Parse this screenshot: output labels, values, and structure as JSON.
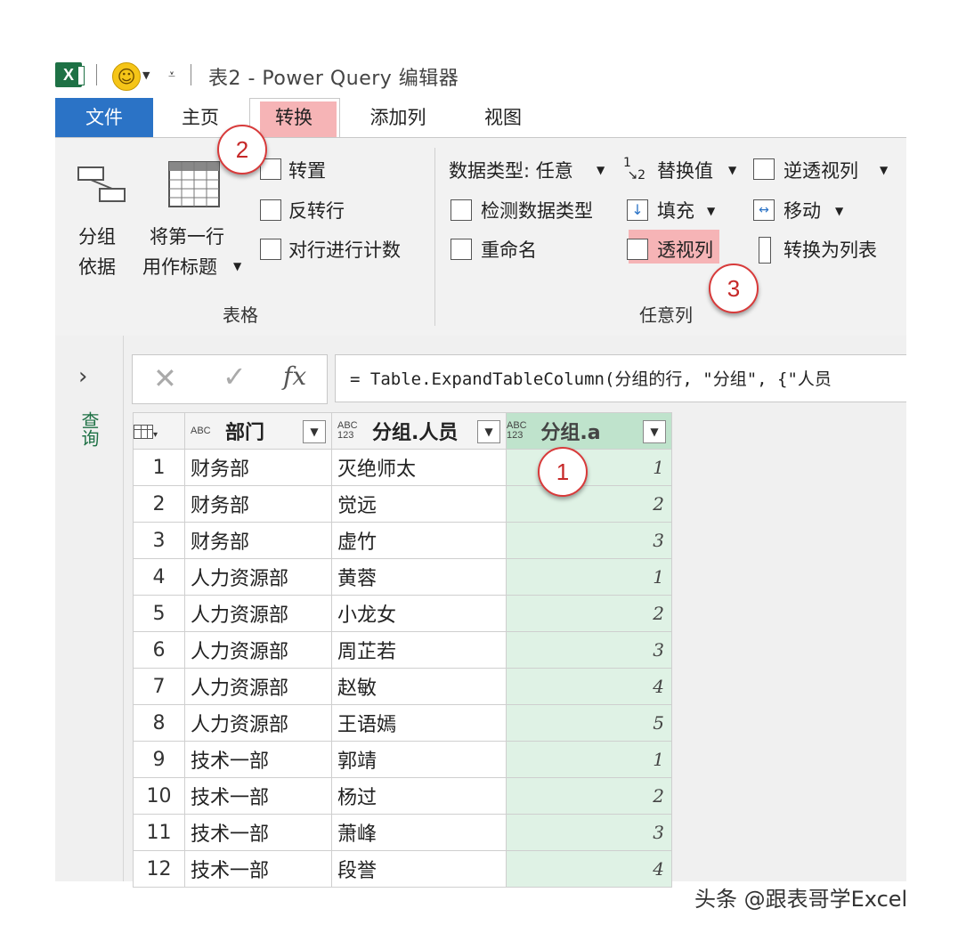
{
  "window": {
    "title": "表2 - Power Query 编辑器"
  },
  "tabs": {
    "file": "文件",
    "home": "主页",
    "transform": "转换",
    "add_column": "添加列",
    "view": "视图"
  },
  "ribbon": {
    "table_group": {
      "label": "表格",
      "group_by_line1": "分组",
      "group_by_line2": "依据",
      "use_first_row_line1": "将第一行",
      "use_first_row_line2": "用作标题",
      "transpose": "转置",
      "reverse_rows": "反转行",
      "count_rows": "对行进行计数"
    },
    "any_column_group": {
      "label": "任意列",
      "data_type": "数据类型: 任意",
      "detect_type": "检测数据类型",
      "rename": "重命名",
      "replace_values": "替换值",
      "fill": "填充",
      "pivot_column": "透视列",
      "unpivot_columns": "逆透视列",
      "move": "移动",
      "convert_to_list": "转换为列表"
    }
  },
  "callouts": {
    "one": "1",
    "two": "2",
    "three": "3"
  },
  "side_panel": {
    "label": "查询"
  },
  "formula_bar": {
    "fx": "fx",
    "formula": "= Table.ExpandTableColumn(分组的行, \"分组\", {\"人员"
  },
  "table": {
    "columns": [
      {
        "type": "ABC",
        "name": "部门"
      },
      {
        "type": "ABC 123",
        "name": "分组.人员"
      },
      {
        "type": "ABC 123",
        "name": "分组.a"
      }
    ],
    "rows": [
      {
        "n": "1",
        "dept": "财务部",
        "person": "灭绝师太",
        "a": "1"
      },
      {
        "n": "2",
        "dept": "财务部",
        "person": "觉远",
        "a": "2"
      },
      {
        "n": "3",
        "dept": "财务部",
        "person": "虚竹",
        "a": "3"
      },
      {
        "n": "4",
        "dept": "人力资源部",
        "person": "黄蓉",
        "a": "1"
      },
      {
        "n": "5",
        "dept": "人力资源部",
        "person": "小龙女",
        "a": "2"
      },
      {
        "n": "6",
        "dept": "人力资源部",
        "person": "周芷若",
        "a": "3"
      },
      {
        "n": "7",
        "dept": "人力资源部",
        "person": "赵敏",
        "a": "4"
      },
      {
        "n": "8",
        "dept": "人力资源部",
        "person": "王语嫣",
        "a": "5"
      },
      {
        "n": "9",
        "dept": "技术一部",
        "person": "郭靖",
        "a": "1"
      },
      {
        "n": "10",
        "dept": "技术一部",
        "person": "杨过",
        "a": "2"
      },
      {
        "n": "11",
        "dept": "技术一部",
        "person": "萧峰",
        "a": "3"
      },
      {
        "n": "12",
        "dept": "技术一部",
        "person": "段誉",
        "a": "4"
      }
    ]
  },
  "watermark": "头条 @跟表哥学Excel"
}
